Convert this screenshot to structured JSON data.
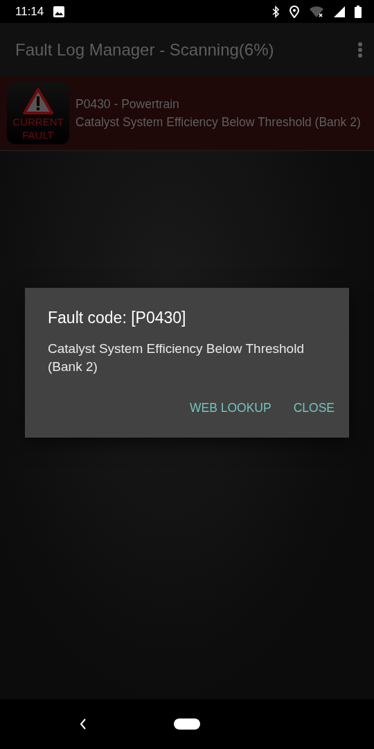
{
  "status_bar": {
    "time": "11:14"
  },
  "app_bar": {
    "title": "Fault Log Manager - Scanning(6%)"
  },
  "faults": [
    {
      "badge_lines": [
        "CURRENT",
        "FAULT"
      ],
      "code": "P0430 - Powertrain",
      "description": "Catalyst System Efficiency Below Threshold (Bank 2)"
    }
  ],
  "dialog": {
    "title": "Fault code: [P0430]",
    "message": "Catalyst System Efficiency Below Threshold (Bank 2)",
    "buttons": [
      "WEB LOOKUP",
      "CLOSE"
    ]
  }
}
